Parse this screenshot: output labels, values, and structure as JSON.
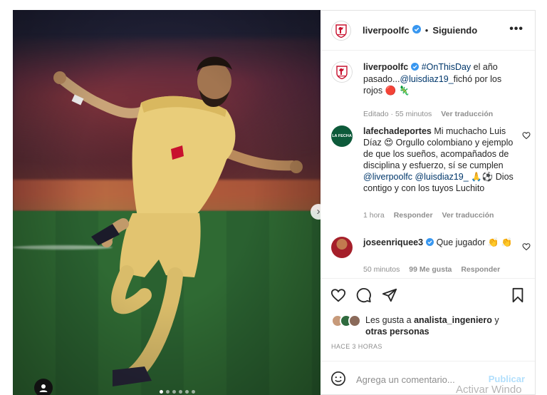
{
  "photo": {
    "alt": "",
    "next_glyph": "›",
    "dots_count": 6,
    "active_dot": 0
  },
  "header": {
    "username": "liverpoolfc",
    "separator": "•",
    "follow_state": "Siguiendo",
    "more": "•••"
  },
  "caption": {
    "username": "liverpoolfc",
    "hashtag": "#OnThisDay",
    "text_a": " el año pasado...",
    "mention": "@luisdiaz19_",
    "text_b": "fichó por los rojos 🔴 🦎",
    "edited": "Editado · 55 minutos",
    "see_translation": "Ver traducción"
  },
  "comments": [
    {
      "username": "lafechadeportes",
      "text_a": "Mi muchacho Luis Díaz 😍 Orgullo colombiano y ejemplo de que los sueños, acompañados de disciplina y esfuerzo, sí se cumplen ",
      "mention1": "@liverpoolfc",
      "mention2": "@luisdiaz19_",
      "text_b": " 🙏⚽ Dios contigo y con los tuyos Luchito",
      "time": "1 hora",
      "reply": "Responder",
      "see_translation": "Ver traducción",
      "avatar_label": "LA FECHA"
    },
    {
      "username": "joseenriquee3",
      "text": "Que jugador 👏 👏",
      "time": "50 minutos",
      "likes": "99 Me gusta",
      "reply": "Responder"
    }
  ],
  "likes": {
    "prefix": "Les gusta a ",
    "user": "analista_ingeniero",
    "middle": " y",
    "others": "otras personas"
  },
  "timestamp": "HACE 3 HORAS",
  "add_comment": {
    "placeholder": "Agrega un comentario...",
    "post_label": "Publicar"
  },
  "watermark": "Activar Windo",
  "colors": {
    "accent_link": "#00376b",
    "hashtag": "#00376b",
    "verified": "#3897f0",
    "muted": "#8e8e8e",
    "post_disabled": "#b2dffc",
    "lfc_red": "#c8102e"
  }
}
